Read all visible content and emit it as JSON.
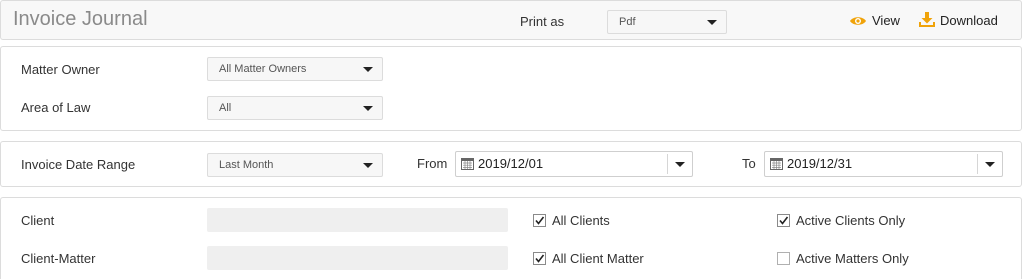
{
  "header": {
    "title": "Invoice Journal",
    "print_as_label": "Print as",
    "print_as_value": "Pdf",
    "view_label": "View",
    "download_label": "Download",
    "accent_color": "#f0a30a"
  },
  "filters": {
    "matter_owner_label": "Matter Owner",
    "matter_owner_value": "All Matter Owners",
    "area_of_law_label": "Area of Law",
    "area_of_law_value": "All"
  },
  "dates": {
    "range_label": "Invoice Date Range",
    "range_value": "Last Month",
    "from_label": "From",
    "from_value": "2019/12/01",
    "to_label": "To",
    "to_value": "2019/12/31"
  },
  "clients": {
    "client_label": "Client",
    "client_value": "",
    "client_matter_label": "Client-Matter",
    "client_matter_value": "",
    "all_clients_label": "All Clients",
    "all_clients_checked": true,
    "active_clients_label": "Active Clients Only",
    "active_clients_checked": true,
    "all_client_matter_label": "All Client Matter",
    "all_client_matter_checked": true,
    "active_matters_label": "Active Matters Only",
    "active_matters_checked": false
  }
}
